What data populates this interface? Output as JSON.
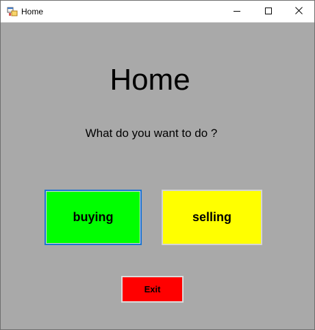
{
  "window": {
    "title": "Home",
    "icon": "app-form-icon"
  },
  "controls": {
    "minimize_icon": "minimize-icon",
    "maximize_icon": "maximize-icon",
    "close_icon": "close-icon"
  },
  "main": {
    "heading": "Home",
    "question": "What do you want to do ?",
    "buttons": {
      "buying": "buying",
      "selling": "selling",
      "exit": "Exit"
    }
  },
  "colors": {
    "background": "#a9a9a9",
    "buying": "#00ff00",
    "selling": "#ffff00",
    "exit": "#ff0000",
    "focus_border": "#1a75d2"
  }
}
